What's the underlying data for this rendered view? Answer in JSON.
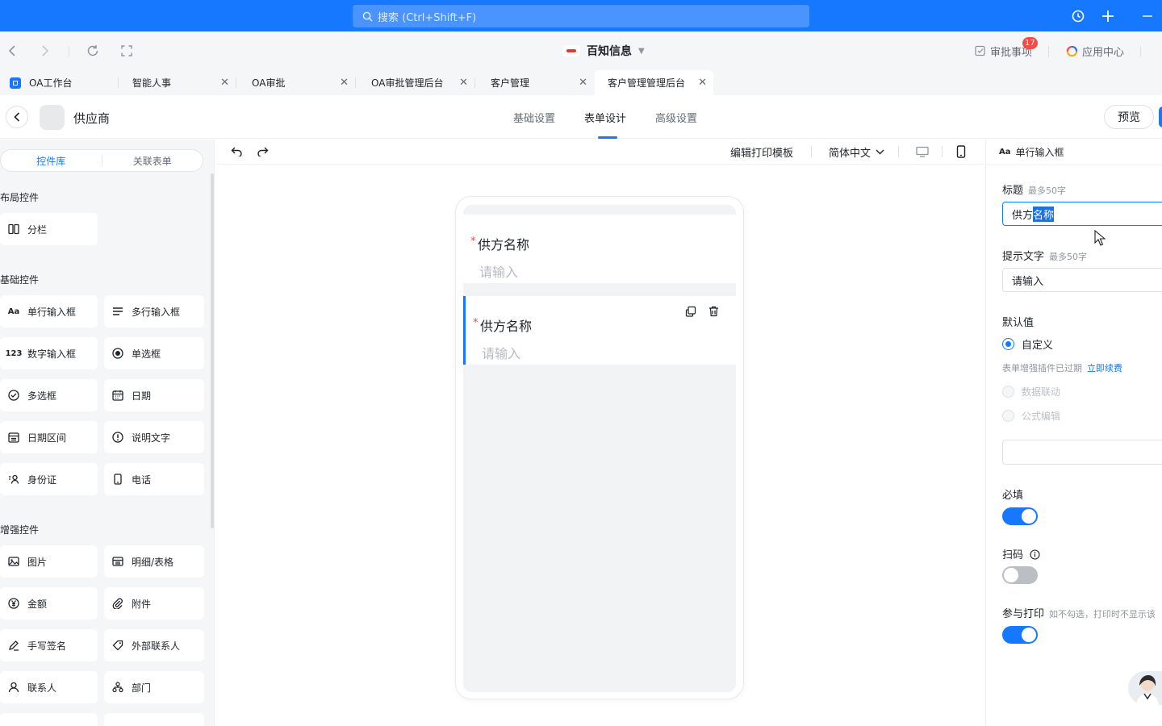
{
  "topbar": {
    "search_placeholder": "搜索 (Ctrl+Shift+F)"
  },
  "nav": {
    "company": "百知信息",
    "approval_label": "审批事项",
    "approval_badge": "17",
    "app_center_label": "应用中心"
  },
  "tabs": [
    {
      "label": "OA工作台"
    },
    {
      "label": "智能人事"
    },
    {
      "label": "OA审批"
    },
    {
      "label": "OA审批管理后台"
    },
    {
      "label": "客户管理"
    },
    {
      "label": "客户管理管理后台"
    }
  ],
  "header": {
    "form_name": "供应商",
    "tabs": [
      "基础设置",
      "表单设计",
      "高级设置"
    ],
    "preview_label": "预览"
  },
  "left": {
    "seg_tabs": [
      "控件库",
      "关联表单"
    ],
    "sections": [
      "布局控件",
      "基础控件",
      "增强控件"
    ],
    "layout_items": [
      {
        "label": "分栏",
        "icon": "columns-icon"
      }
    ],
    "basic_items": [
      {
        "label": "单行输入框",
        "icon": "text-aa-icon"
      },
      {
        "label": "多行输入框",
        "icon": "multiline-icon"
      },
      {
        "label": "数字输入框",
        "icon": "number-icon"
      },
      {
        "label": "单选框",
        "icon": "radio-icon"
      },
      {
        "label": "多选框",
        "icon": "check-circle-icon"
      },
      {
        "label": "日期",
        "icon": "calendar-icon"
      },
      {
        "label": "日期区间",
        "icon": "date-range-icon"
      },
      {
        "label": "说明文字",
        "icon": "info-icon"
      },
      {
        "label": "身份证",
        "icon": "id-card-icon"
      },
      {
        "label": "电话",
        "icon": "phone-icon"
      }
    ],
    "advanced_items": [
      {
        "label": "图片",
        "icon": "image-icon"
      },
      {
        "label": "明细/表格",
        "icon": "table-icon"
      },
      {
        "label": "金额",
        "icon": "yen-icon"
      },
      {
        "label": "附件",
        "icon": "paperclip-icon"
      },
      {
        "label": "手写签名",
        "icon": "signature-icon"
      },
      {
        "label": "外部联系人",
        "icon": "tag-icon"
      },
      {
        "label": "联系人",
        "icon": "person-icon"
      },
      {
        "label": "部门",
        "icon": "org-icon"
      }
    ]
  },
  "canvas": {
    "print_template": "编辑打印模板",
    "language": "简体中文",
    "fields": [
      {
        "label": "供方名称",
        "placeholder": "请输入"
      },
      {
        "label": "供方名称",
        "placeholder": "请输入"
      }
    ]
  },
  "right": {
    "header": "单行输入框",
    "title_label": "标题",
    "title_hint": "最多50字",
    "title_value_plain": "供方",
    "title_value_selected": "名称",
    "placeholder_label": "提示文字",
    "placeholder_hint": "最多50字",
    "placeholder_value": "请输入",
    "default_label": "默认值",
    "opt_custom": "自定义",
    "plugin_note": "表单增强插件已过期",
    "renew_link": "立即续费",
    "opt_linkage": "数据联动",
    "opt_formula": "公式编辑",
    "required_label": "必填",
    "scan_label": "扫码",
    "print_label": "参与打印",
    "print_hint": "如不勾选，打印时不显示该"
  },
  "switches": {
    "required": true,
    "scan": false,
    "print": true
  }
}
